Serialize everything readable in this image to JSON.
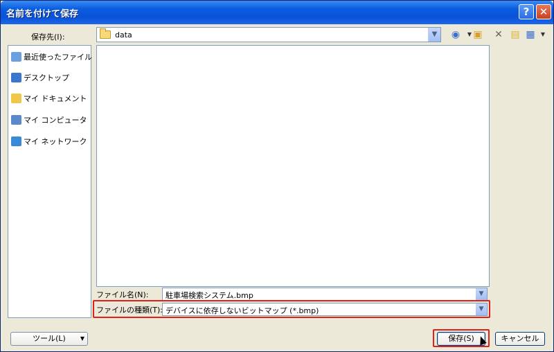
{
  "window": {
    "title": "名前を付けて保存",
    "help_label": "?",
    "close_label": "✕"
  },
  "save_in": {
    "label": "保存先(I):",
    "value": "data"
  },
  "toolbar": {
    "back_icon": "back-icon",
    "up_folder_icon": "up-folder-icon",
    "delete_icon": "delete-icon",
    "new_folder_icon": "new-folder-icon",
    "view_menu_icon": "view-menu-icon"
  },
  "places": {
    "items": [
      {
        "label": "最近使ったファイル",
        "icon": "recent-icon",
        "color": "#6aa0e0"
      },
      {
        "label": "デスクトップ",
        "icon": "desktop-icon",
        "color": "#3a78d0"
      },
      {
        "label": "マイ ドキュメント",
        "icon": "documents-icon",
        "color": "#f0c848"
      },
      {
        "label": "マイ コンピュータ",
        "icon": "computer-icon",
        "color": "#5a88c8"
      },
      {
        "label": "マイ ネットワーク",
        "icon": "network-icon",
        "color": "#3a8ad8"
      }
    ]
  },
  "filename": {
    "label": "ファイル名(N):",
    "value": "駐車場検索システム.bmp"
  },
  "filetype": {
    "label": "ファイルの種類(T):",
    "value": "デバイスに依存しないビットマップ (*.bmp)"
  },
  "buttons": {
    "tools": "ツール(L)",
    "save": "保存(S)",
    "cancel": "キャンセル"
  },
  "colors": {
    "highlight": "#e0201a",
    "titlebar": "#0a52d8"
  }
}
